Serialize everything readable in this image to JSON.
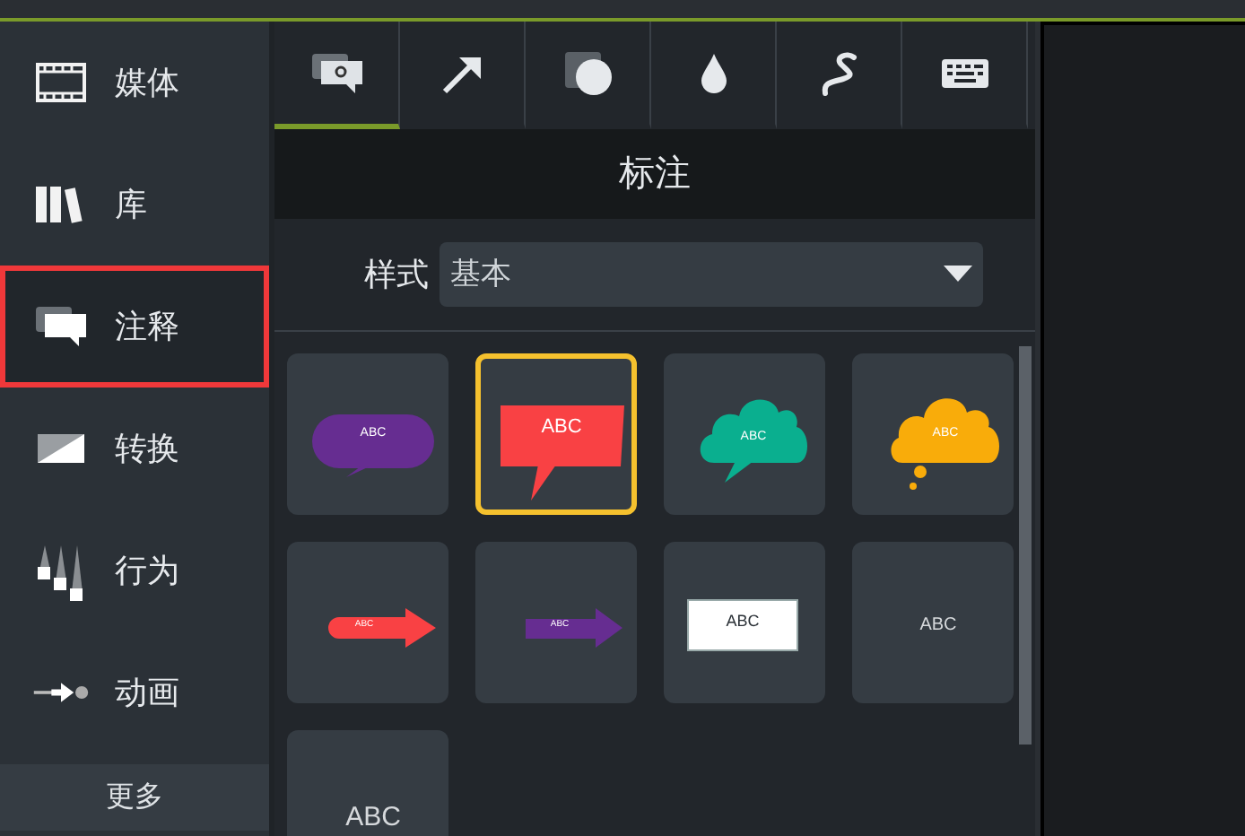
{
  "sidebar": {
    "items": [
      {
        "label": "媒体",
        "selected": false,
        "highlighted": false
      },
      {
        "label": "库",
        "selected": false,
        "highlighted": false
      },
      {
        "label": "注释",
        "selected": true,
        "highlighted": true
      },
      {
        "label": "转换",
        "selected": false,
        "highlighted": false
      },
      {
        "label": "行为",
        "selected": false,
        "highlighted": false
      },
      {
        "label": "动画",
        "selected": false,
        "highlighted": false
      }
    ],
    "more_button": "更多"
  },
  "tabs": [
    {
      "selected": true
    },
    {
      "selected": false
    },
    {
      "selected": false
    },
    {
      "selected": false
    },
    {
      "selected": false
    },
    {
      "selected": false
    }
  ],
  "panel": {
    "title": "标注",
    "style_label": "样式",
    "style_value": "基本",
    "tiles": [
      {
        "kind": "round-bubble",
        "color": "#662d91",
        "text": "ABC",
        "selected": false
      },
      {
        "kind": "rect-bubble",
        "color": "#f94144",
        "text": "ABC",
        "selected": true
      },
      {
        "kind": "cloud",
        "color": "#0aaf8f",
        "text": "ABC",
        "selected": false
      },
      {
        "kind": "thought",
        "color": "#f9ac0a",
        "text": "ABC",
        "selected": false
      },
      {
        "kind": "round-arrow",
        "color": "#f94144",
        "text": "ABC",
        "selected": false
      },
      {
        "kind": "arrow",
        "color": "#662d91",
        "text": "ABC",
        "selected": false
      },
      {
        "kind": "box",
        "color": "#ffffff",
        "text": "ABC",
        "selected": false
      },
      {
        "kind": "text",
        "text": "ABC",
        "selected": false
      },
      {
        "kind": "large-text",
        "text": "ABC",
        "selected": false
      }
    ]
  }
}
